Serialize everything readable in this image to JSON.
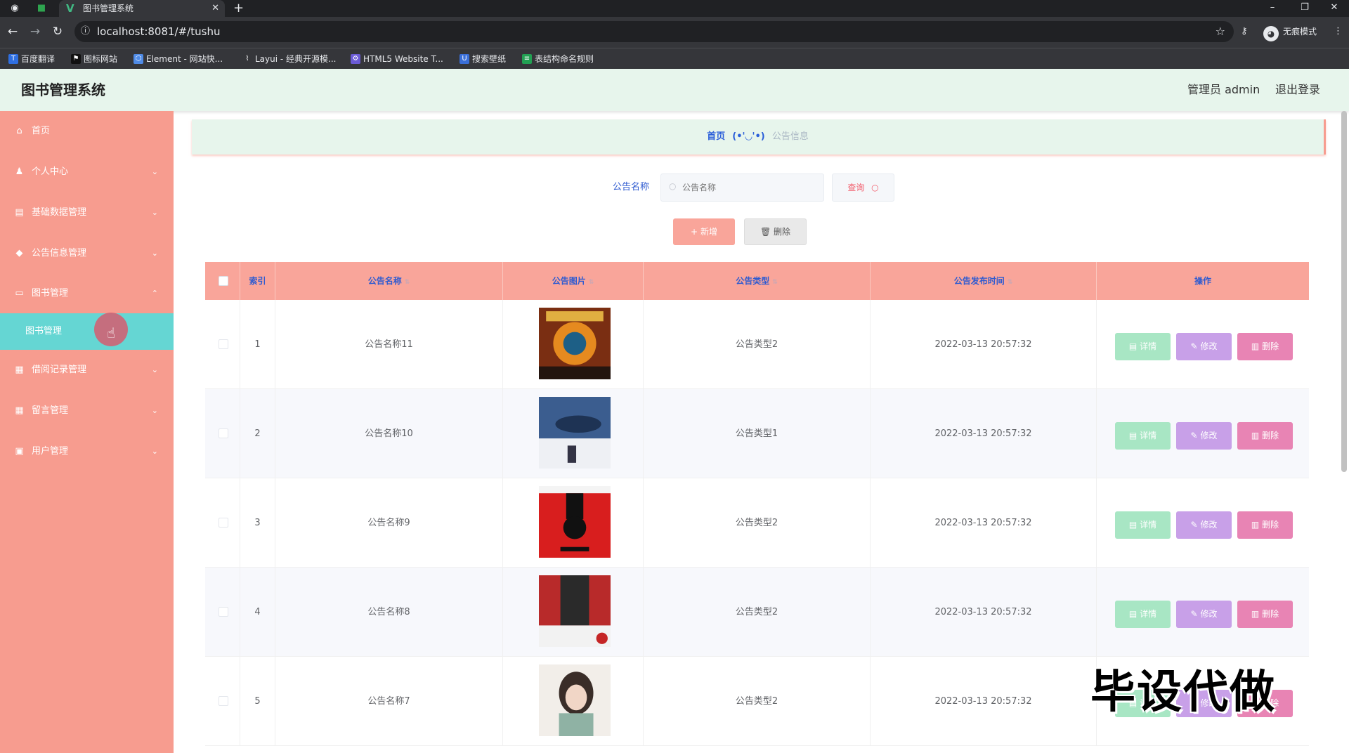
{
  "browser": {
    "tab_title": "图书管理系统",
    "url": "localhost:8081/#/tushu",
    "incognito_label": "无痕模式",
    "bookmarks": [
      "百度翻译",
      "图标网站",
      "Element - 网站快...",
      "Layui - 经典开源模...",
      "HTML5 Website T...",
      "搜索壁纸",
      "表结构命名规则"
    ]
  },
  "header": {
    "title": "图书管理系统",
    "user": "管理员 admin",
    "logout": "退出登录"
  },
  "sidebar": {
    "items": [
      {
        "label": "首页",
        "icon": "home-icon"
      },
      {
        "label": "个人中心",
        "icon": "user-icon"
      },
      {
        "label": "基础数据管理",
        "icon": "database-icon"
      },
      {
        "label": "公告信息管理",
        "icon": "bulb-icon"
      },
      {
        "label": "图书管理",
        "icon": "book-icon"
      },
      {
        "label": "借阅记录管理",
        "icon": "grid-icon"
      },
      {
        "label": "留言管理",
        "icon": "table-icon"
      },
      {
        "label": "用户管理",
        "icon": "user-manage-icon"
      }
    ],
    "active_sub": "图书管理"
  },
  "breadcrumb": {
    "home": "首页",
    "face": "(•'◡'•)",
    "current": "公告信息"
  },
  "search": {
    "label": "公告名称",
    "placeholder": "公告名称",
    "query_button": "查询"
  },
  "actions": {
    "add": "新增",
    "delete": "删除"
  },
  "table": {
    "columns": [
      "索引",
      "公告名称",
      "公告图片",
      "公告类型",
      "公告发布时间",
      "操作"
    ],
    "rows": [
      {
        "index": "1",
        "name": "公告名称11",
        "type": "公告类型2",
        "time": "2022-03-13 20:57:32"
      },
      {
        "index": "2",
        "name": "公告名称10",
        "type": "公告类型1",
        "time": "2022-03-13 20:57:32"
      },
      {
        "index": "3",
        "name": "公告名称9",
        "type": "公告类型2",
        "time": "2022-03-13 20:57:32"
      },
      {
        "index": "4",
        "name": "公告名称8",
        "type": "公告类型2",
        "time": "2022-03-13 20:57:32"
      },
      {
        "index": "5",
        "name": "公告名称7",
        "type": "公告类型2",
        "time": "2022-03-13 20:57:32"
      }
    ],
    "row_actions": {
      "detail": "详情",
      "edit": "修改",
      "delete": "删除"
    }
  },
  "watermark": "毕设代做",
  "colors": {
    "sidebar": "#f79c8f",
    "header_bg": "#e7f5ec",
    "submenu_active": "#65d6d3",
    "table_header": "#f9a59a",
    "detail_btn": "#a8e6c4",
    "edit_btn": "#c8a0e8",
    "delete_btn": "#e884b4"
  }
}
